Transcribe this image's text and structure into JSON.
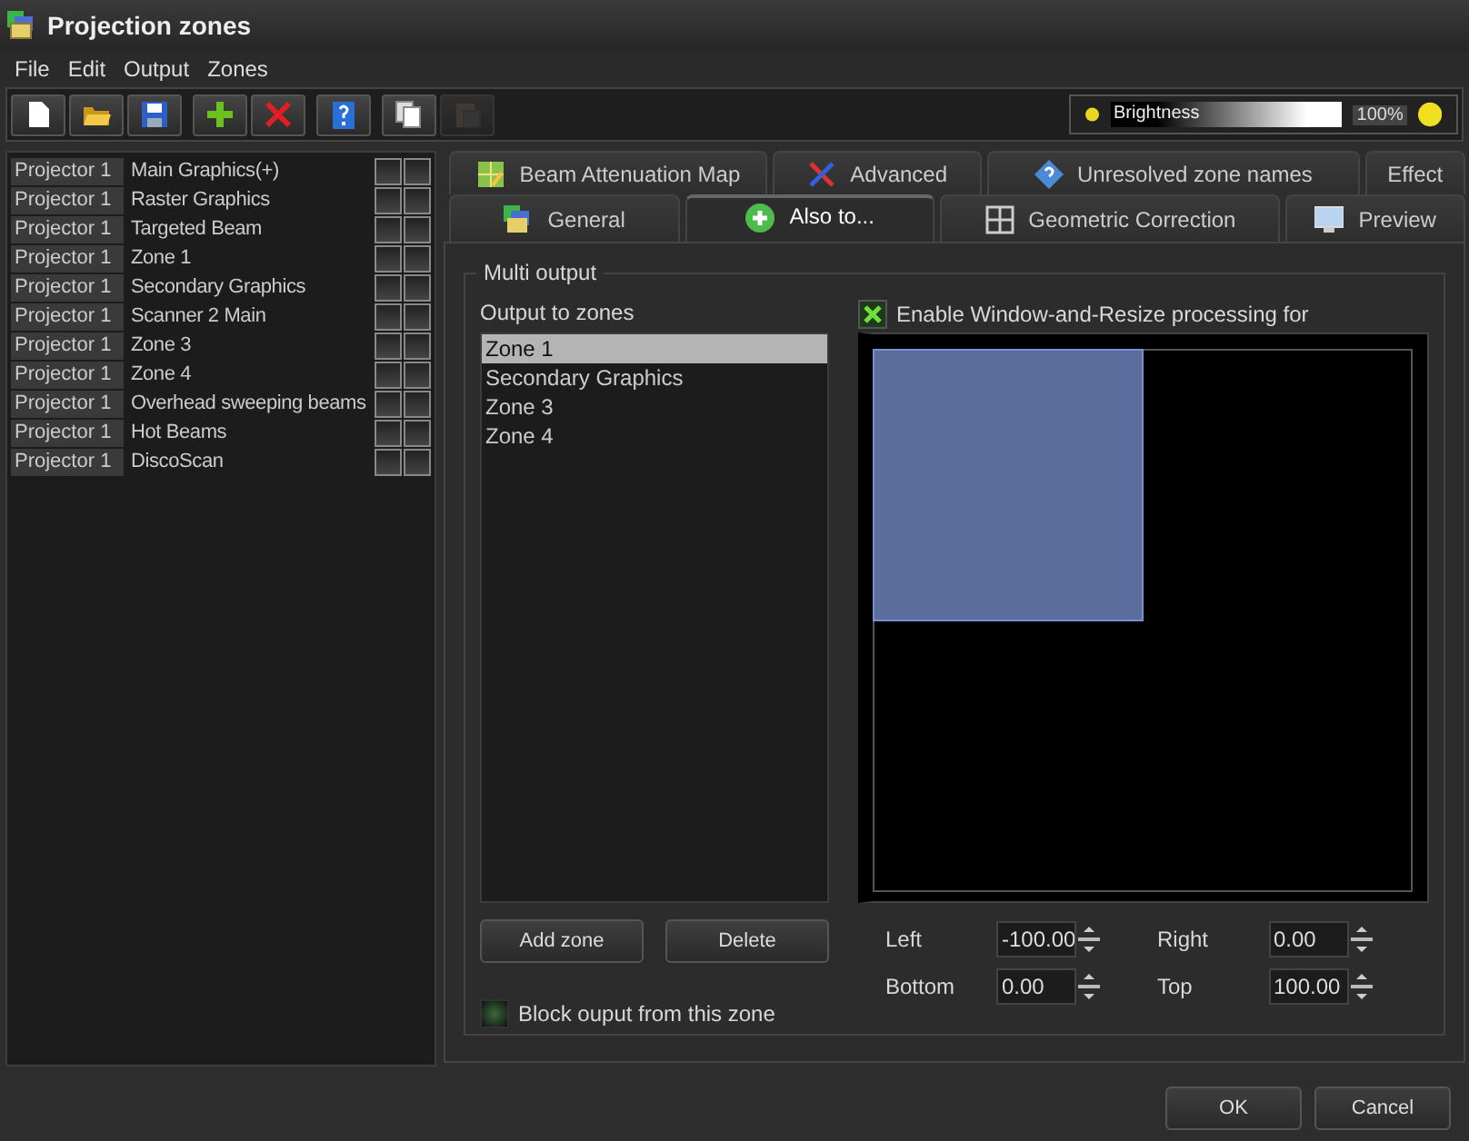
{
  "window": {
    "title": "Projection zones"
  },
  "menu": [
    "File",
    "Edit",
    "Output",
    "Zones"
  ],
  "toolbar_groups": [
    [
      {
        "disabled": false
      },
      {
        "disabled": false
      },
      {
        "disabled": false
      }
    ],
    [
      {
        "disabled": false
      },
      {
        "disabled": false
      }
    ],
    [
      {
        "disabled": false
      }
    ],
    [
      {
        "disabled": false
      },
      {
        "disabled": true
      }
    ]
  ],
  "brightness": {
    "label": "Brightness",
    "level": 1.0,
    "reading": "100%"
  },
  "zones": [
    {
      "projector": "Projector 1",
      "name": "Main Graphics(+)",
      "checks": [
        false,
        false
      ]
    },
    {
      "projector": "Projector 1",
      "name": "Raster Graphics",
      "checks": [
        false,
        false
      ]
    },
    {
      "projector": "Projector 1",
      "name": "Targeted Beam",
      "checks": [
        false,
        false
      ]
    },
    {
      "projector": "Projector 1",
      "name": "Zone 1",
      "checks": [
        false,
        false
      ]
    },
    {
      "projector": "Projector 1",
      "name": "Secondary Graphics",
      "checks": [
        false,
        false
      ]
    },
    {
      "projector": "Projector 1",
      "name": "Scanner 2 Main",
      "checks": [
        false,
        false
      ]
    },
    {
      "projector": "Projector 1",
      "name": "Zone 3",
      "checks": [
        false,
        false
      ]
    },
    {
      "projector": "Projector 1",
      "name": "Zone 4",
      "checks": [
        false,
        false
      ]
    },
    {
      "projector": "Projector 1",
      "name": "Overhead sweeping beams",
      "checks": [
        false,
        false
      ]
    },
    {
      "projector": "Projector 1",
      "name": "Hot Beams",
      "checks": [
        false,
        false
      ]
    },
    {
      "projector": "Projector 1",
      "name": "DiscoScan",
      "checks": [
        false,
        false
      ]
    }
  ],
  "tab_rows": [
    [
      {
        "label": "Beam Attenuation Map",
        "selected": false
      },
      {
        "label": "Advanced",
        "selected": false
      },
      {
        "label": "Unresolved zone names",
        "selected": false
      },
      {
        "label": "Effect",
        "selected": false
      }
    ],
    [
      {
        "label": "General",
        "selected": false
      },
      {
        "label": "Also to...",
        "selected": true
      },
      {
        "label": "Geometric Correction",
        "selected": false
      },
      {
        "label": "Preview",
        "selected": false
      }
    ]
  ],
  "multi_output": {
    "title": "Multi output",
    "list_label": "Output to zones",
    "zones": [
      {
        "label": "Zone 1",
        "selected": true
      },
      {
        "label": "Secondary Graphics",
        "selected": false
      },
      {
        "label": "Zone 3",
        "selected": false
      },
      {
        "label": "Zone 4",
        "selected": false
      }
    ],
    "buttons": [
      "Add zone",
      "Delete"
    ],
    "block": {
      "label": "Block ouput from this zone",
      "checked": false
    },
    "window_resize": {
      "label": "Enable Window-and-Resize processing for",
      "checked": true
    },
    "fields": [
      {
        "label": "Left",
        "value": "-100.00"
      },
      {
        "label": "Right",
        "value": "0.00"
      },
      {
        "label": "Bottom",
        "value": "0.00"
      },
      {
        "label": "Top",
        "value": "100.00"
      }
    ]
  },
  "dialog_buttons": [
    "OK",
    "Cancel"
  ]
}
